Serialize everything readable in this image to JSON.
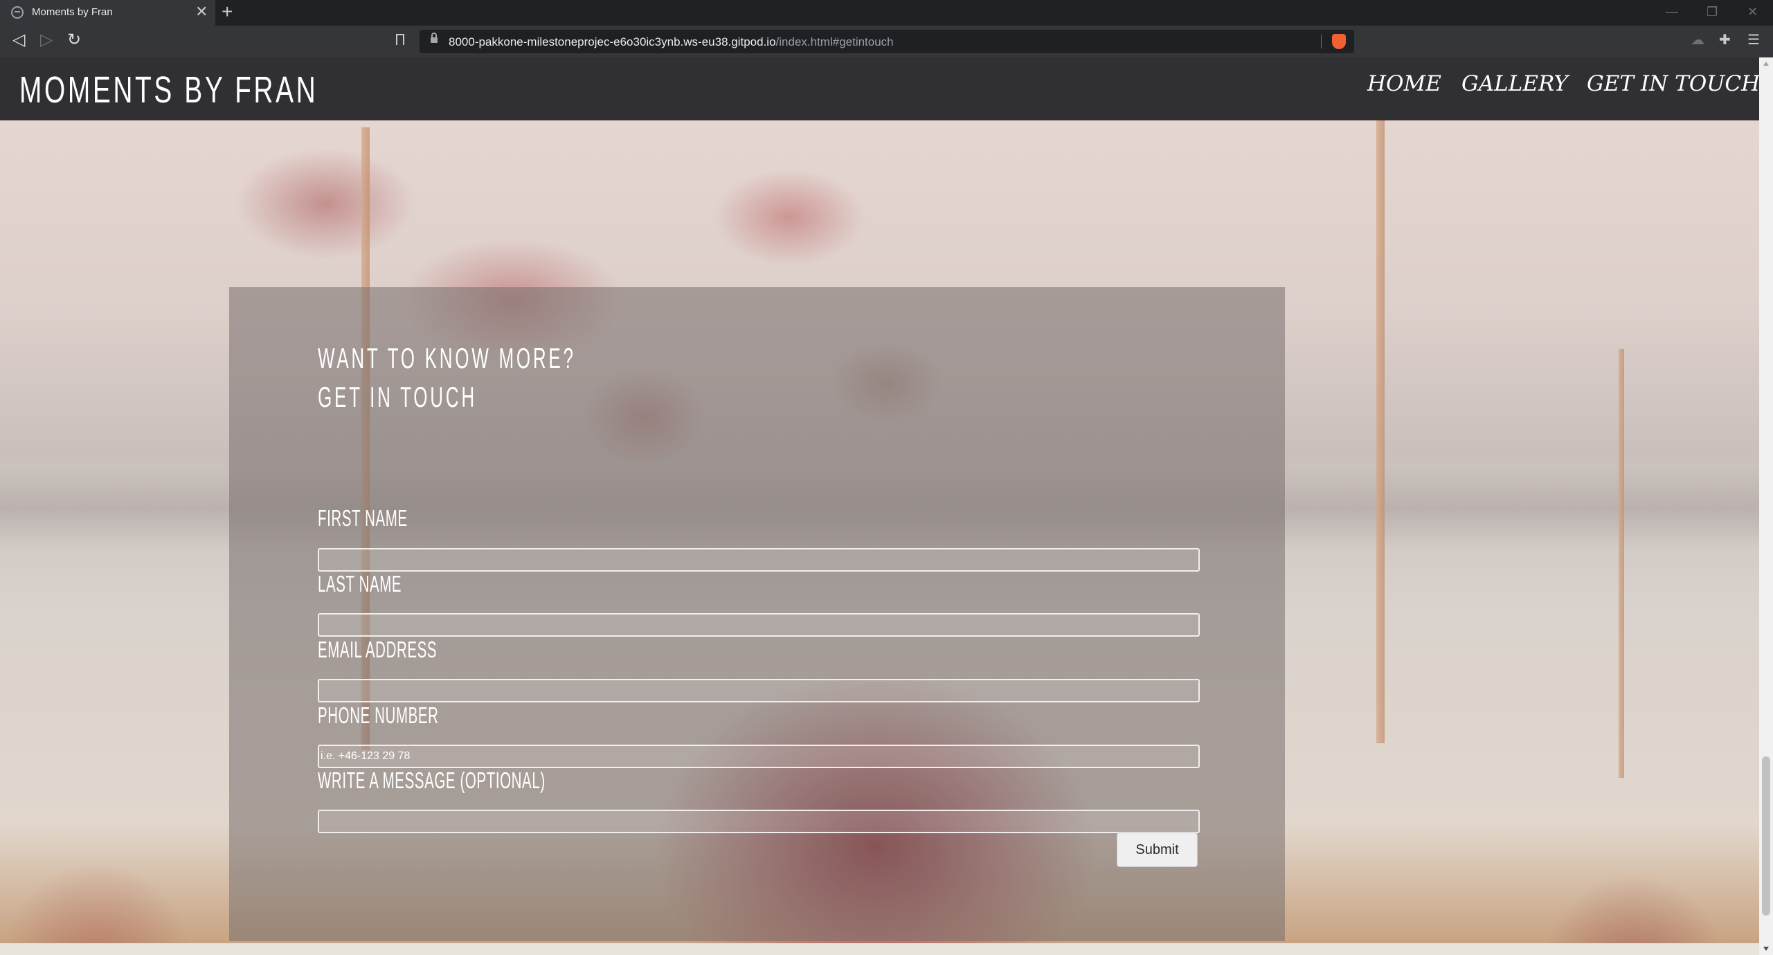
{
  "browser": {
    "tab_title": "Moments by Fran",
    "tab_close": "✕",
    "new_tab": "+",
    "url_host": "8000-pakkone-milestoneprojec-e6o30ic3ynb.ws-eu38.gitpod.io",
    "url_path": "/index.html#getintouch",
    "nav": {
      "back": "◁",
      "forward": "▷",
      "reload": "↻"
    },
    "window_controls": {
      "minimize": "—",
      "restore": "❐",
      "close": "✕"
    },
    "extensions": {
      "cloud": "☁",
      "puzzle": "✚",
      "menu": "☰"
    }
  },
  "site": {
    "brand": "MOMENTS BY FRAN",
    "nav": [
      "HOME",
      "GALLERY",
      "GET IN TOUCH"
    ]
  },
  "form": {
    "heading_line1": "WANT TO KNOW MORE?",
    "heading_line2": "GET IN TOUCH",
    "fields": [
      {
        "label": "FIRST NAME",
        "placeholder": "",
        "value": ""
      },
      {
        "label": "LAST NAME",
        "placeholder": "",
        "value": ""
      },
      {
        "label": "EMAIL ADDRESS",
        "placeholder": "",
        "value": ""
      },
      {
        "label": "PHONE NUMBER",
        "placeholder": "i.e. +46-123 29 78",
        "value": ""
      },
      {
        "label": "WRITE A MESSAGE (OPTIONAL)",
        "placeholder": "",
        "value": ""
      }
    ],
    "submit_label": "Submit"
  },
  "colors": {
    "header_bg": "#302f33",
    "chrome_bg": "#202124",
    "toolbar_bg": "#35363a",
    "form_overlay": "rgba(120,112,110,0.55)",
    "accent_brave": "#f26134"
  }
}
